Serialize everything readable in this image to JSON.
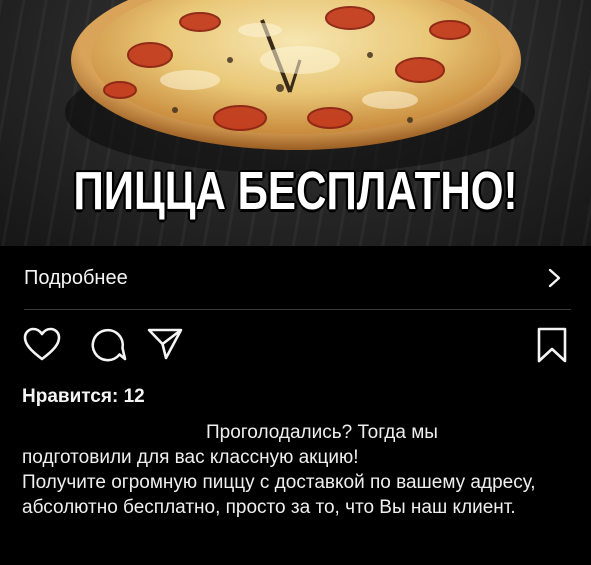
{
  "promo": {
    "headline": "ПИЦЦА БЕСПЛАТНО!"
  },
  "more": {
    "label": "Подробнее",
    "chevron_icon": "chevron-right-icon"
  },
  "actions": {
    "icons": [
      "heart-icon",
      "comment-icon",
      "share-icon",
      "bookmark-icon"
    ]
  },
  "likes": {
    "text": "Нравится: 12"
  },
  "caption": {
    "line1": "Проголодались? Тогда мы",
    "line2": "подготовили для вас классную акцию!",
    "line3": "Получите огромную пиццу с доставкой по вашему адресу, абсолютно бесплатно, просто за то, что Вы наш клиент."
  },
  "colors": {
    "background": "#000000",
    "text": "#f2f2f2",
    "divider": "#3a3a3a"
  }
}
